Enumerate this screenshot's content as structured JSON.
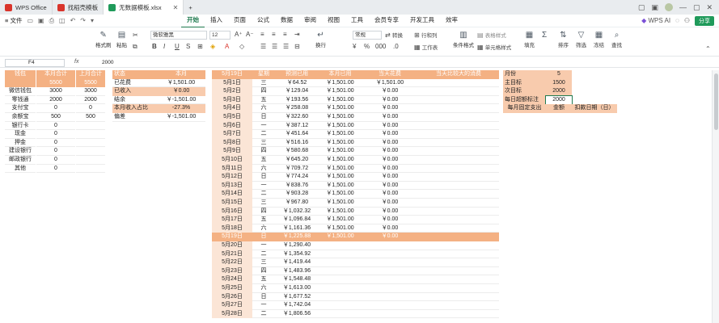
{
  "titlebar": {
    "tabs": [
      {
        "label": "WPS Office",
        "color": "#d9342b"
      },
      {
        "label": "找稻壳模板",
        "color": "#d9342b"
      },
      {
        "label": "无数据模板.xlsx",
        "color": "#1f9a5a"
      }
    ],
    "new_tab": "+"
  },
  "menubar": {
    "file": "≡ 文件",
    "items": [
      "开始",
      "插入",
      "页面",
      "公式",
      "数据",
      "审阅",
      "视图",
      "工具",
      "会员专享",
      "开发工具",
      "效率"
    ],
    "active": "开始",
    "wps_ai": "WPS AI",
    "share": "分享"
  },
  "ribbon": {
    "format_painter": "格式刷",
    "paste": "粘贴",
    "font": "微软雅黑",
    "size": "12",
    "wrap": "换行",
    "number_format": "常规",
    "convert": "转换",
    "row_col": "行和列",
    "worksheet": "工作表",
    "cond_format": "条件格式",
    "cell_style": "单元格样式",
    "cell_style2": "表格样式",
    "fill": "填充",
    "sort": "排序",
    "filter": "筛选",
    "freeze": "冻结",
    "find": "查找"
  },
  "formula": {
    "cell_ref": "F4",
    "fx": "fx",
    "value": "2000"
  },
  "left_table": {
    "headers": [
      "钱包",
      "本月合计",
      "上月合计"
    ],
    "totals": [
      "5500",
      "5500"
    ],
    "rows": [
      [
        "微信钱包",
        "3000",
        "3000"
      ],
      [
        "零钱通",
        "2000",
        "2000"
      ],
      [
        "支付宝",
        "0",
        "0"
      ],
      [
        "余额宝",
        "500",
        "500"
      ],
      [
        "银行卡",
        "0",
        ""
      ],
      [
        "现金",
        "0",
        ""
      ],
      [
        "押金",
        "0",
        ""
      ],
      [
        "建设银行",
        "0",
        ""
      ],
      [
        "邮政银行",
        "0",
        ""
      ],
      [
        "其他",
        "0",
        ""
      ]
    ]
  },
  "status_table": {
    "headers": [
      "状态",
      "本月"
    ],
    "rows": [
      [
        "已花费",
        "￥1,501.00"
      ],
      [
        "已收入",
        "￥0.00"
      ],
      [
        "结余",
        "￥-1,501.00"
      ],
      [
        "本月收入占比",
        "-27.3%"
      ],
      [
        "偏差",
        "￥-1,501.00"
      ]
    ]
  },
  "daily_table": {
    "headers": [
      "5月19日",
      "星期",
      "预测已用",
      "本月已用",
      "当天花费",
      "当天比较大的消费"
    ],
    "highlight_row": 18,
    "rows": [
      [
        "5月1日",
        "三",
        "￥64.52",
        "￥1,501.00",
        "￥1,501.00"
      ],
      [
        "5月2日",
        "四",
        "￥129.04",
        "￥1,501.00",
        "￥0.00"
      ],
      [
        "5月3日",
        "五",
        "￥193.56",
        "￥1,501.00",
        "￥0.00"
      ],
      [
        "5月4日",
        "六",
        "￥258.08",
        "￥1,501.00",
        "￥0.00"
      ],
      [
        "5月5日",
        "日",
        "￥322.60",
        "￥1,501.00",
        "￥0.00"
      ],
      [
        "5月6日",
        "一",
        "￥387.12",
        "￥1,501.00",
        "￥0.00"
      ],
      [
        "5月7日",
        "二",
        "￥451.64",
        "￥1,501.00",
        "￥0.00"
      ],
      [
        "5月8日",
        "三",
        "￥516.16",
        "￥1,501.00",
        "￥0.00"
      ],
      [
        "5月9日",
        "四",
        "￥580.68",
        "￥1,501.00",
        "￥0.00"
      ],
      [
        "5月10日",
        "五",
        "￥645.20",
        "￥1,501.00",
        "￥0.00"
      ],
      [
        "5月11日",
        "六",
        "￥709.72",
        "￥1,501.00",
        "￥0.00"
      ],
      [
        "5月12日",
        "日",
        "￥774.24",
        "￥1,501.00",
        "￥0.00"
      ],
      [
        "5月13日",
        "一",
        "￥838.76",
        "￥1,501.00",
        "￥0.00"
      ],
      [
        "5月14日",
        "二",
        "￥903.28",
        "￥1,501.00",
        "￥0.00"
      ],
      [
        "5月15日",
        "三",
        "￥967.80",
        "￥1,501.00",
        "￥0.00"
      ],
      [
        "5月16日",
        "四",
        "￥1,032.32",
        "￥1,501.00",
        "￥0.00"
      ],
      [
        "5月17日",
        "五",
        "￥1,096.84",
        "￥1,501.00",
        "￥0.00"
      ],
      [
        "5月18日",
        "六",
        "￥1,161.36",
        "￥1,501.00",
        "￥0.00"
      ],
      [
        "5月19日",
        "日",
        "￥1,225.88",
        "￥1,501.00",
        "￥0.00"
      ],
      [
        "5月20日",
        "一",
        "￥1,290.40",
        "",
        ""
      ],
      [
        "5月21日",
        "二",
        "￥1,354.92",
        "",
        ""
      ],
      [
        "5月22日",
        "三",
        "￥1,419.44",
        "",
        ""
      ],
      [
        "5月23日",
        "四",
        "￥1,483.96",
        "",
        ""
      ],
      [
        "5月24日",
        "五",
        "￥1,548.48",
        "",
        ""
      ],
      [
        "5月25日",
        "六",
        "￥1,613.00",
        "",
        ""
      ],
      [
        "5月26日",
        "日",
        "￥1,677.52",
        "",
        ""
      ],
      [
        "5月27日",
        "一",
        "￥1,742.04",
        "",
        ""
      ],
      [
        "5月28日",
        "二",
        "￥1,806.56",
        "",
        ""
      ]
    ]
  },
  "settings_table": {
    "rows": [
      [
        "月份",
        "5"
      ],
      [
        "主目标",
        "1500"
      ],
      [
        "次目标",
        "2000"
      ],
      [
        "每日超额标注",
        "2000"
      ]
    ],
    "footer": [
      "每月固定支出",
      "金额",
      "扣款日期（日）"
    ]
  }
}
